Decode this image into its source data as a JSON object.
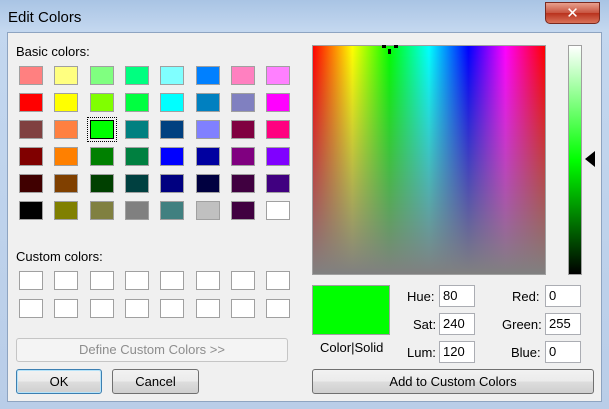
{
  "window": {
    "title": "Edit Colors",
    "close_glyph": "✕"
  },
  "basic_colors": {
    "label": "Basic colors:",
    "rows": [
      [
        "#ff8080",
        "#ffff80",
        "#80ff80",
        "#00ff80",
        "#80ffff",
        "#0080ff",
        "#ff80c0",
        "#ff80ff"
      ],
      [
        "#ff0000",
        "#ffff00",
        "#80ff00",
        "#00ff40",
        "#00ffff",
        "#0080c0",
        "#8080c0",
        "#ff00ff"
      ],
      [
        "#804040",
        "#ff8040",
        "#00ff00",
        "#008080",
        "#004080",
        "#8080ff",
        "#800040",
        "#ff0080"
      ],
      [
        "#800000",
        "#ff8000",
        "#008000",
        "#008040",
        "#0000ff",
        "#0000a0",
        "#800080",
        "#8000ff"
      ],
      [
        "#400000",
        "#804000",
        "#004000",
        "#004040",
        "#000080",
        "#000040",
        "#400040",
        "#400080"
      ],
      [
        "#000000",
        "#808000",
        "#808040",
        "#808080",
        "#408080",
        "#c0c0c0",
        "#400040",
        "#ffffff"
      ]
    ],
    "selected_row": 2,
    "selected_col": 2
  },
  "custom_colors": {
    "label": "Custom colors:",
    "rows": 2,
    "cols": 8
  },
  "buttons": {
    "define_custom": "Define Custom Colors >>",
    "ok": "OK",
    "cancel": "Cancel",
    "add_custom": "Add to Custom Colors"
  },
  "preview": {
    "label": "Color|Solid",
    "color": "#00ff00"
  },
  "fields": {
    "hue": {
      "label": "Hue:",
      "value": "80"
    },
    "sat": {
      "label": "Sat:",
      "value": "240"
    },
    "lum": {
      "label": "Lum:",
      "value": "120"
    },
    "red": {
      "label": "Red:",
      "value": "0"
    },
    "green": {
      "label": "Green:",
      "value": "255"
    },
    "blue": {
      "label": "Blue:",
      "value": "0"
    }
  },
  "icons": {
    "crosshair": "crosshair-icon",
    "lum_arrow": "luminosity-arrow-icon"
  }
}
